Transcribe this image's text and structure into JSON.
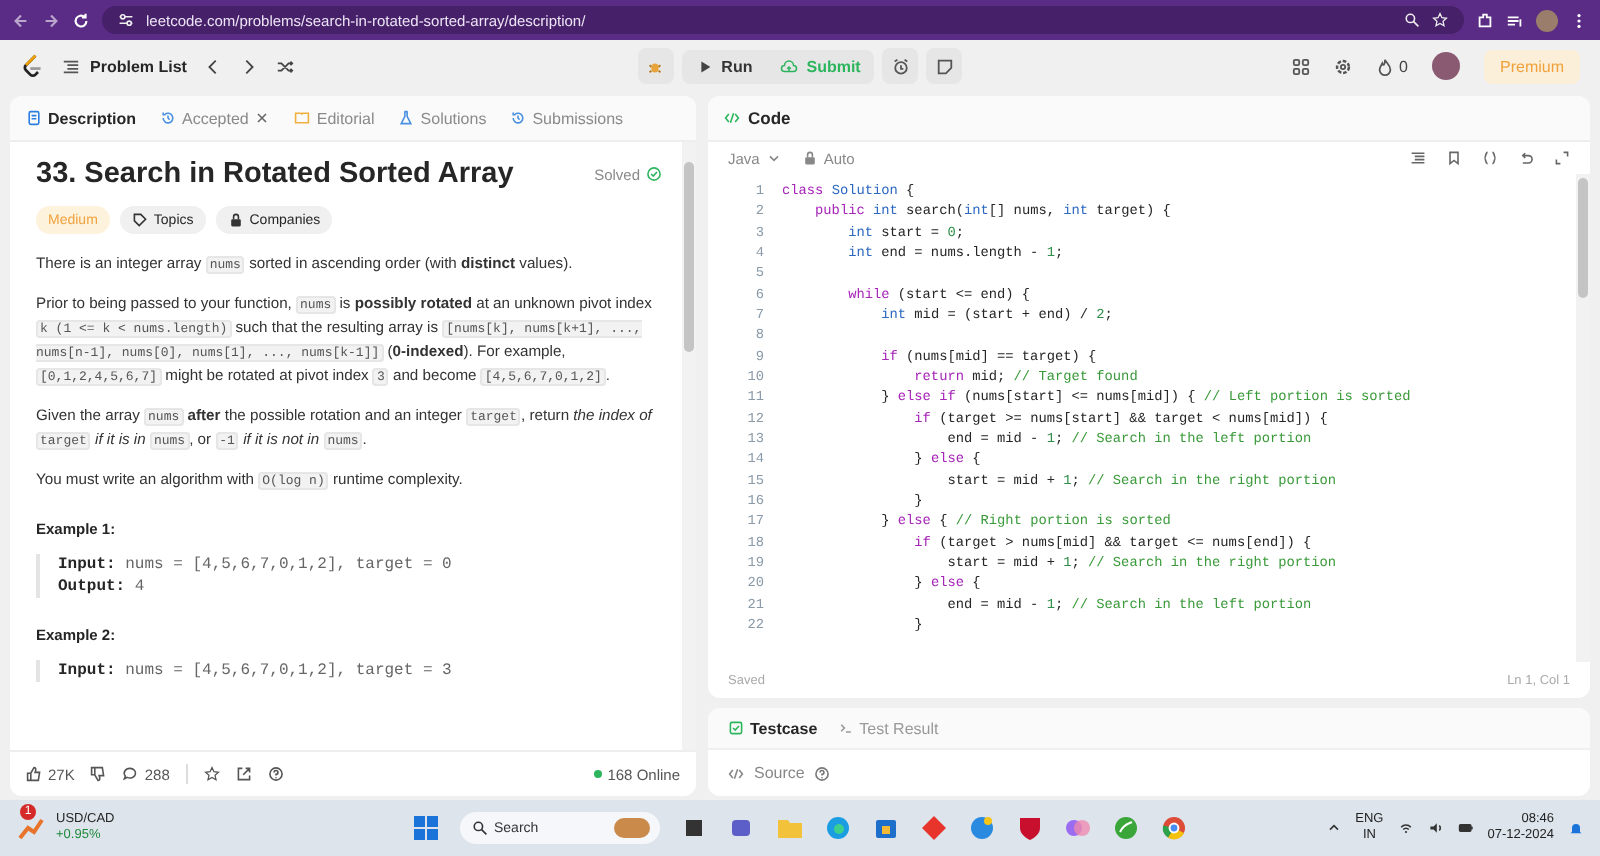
{
  "browser": {
    "url": "leetcode.com/problems/search-in-rotated-sorted-array/description/"
  },
  "nav": {
    "problem_list": "Problem List",
    "run": "Run",
    "submit": "Submit",
    "streak": "0",
    "premium": "Premium"
  },
  "description_tabs": [
    {
      "label": "Description",
      "selected": true,
      "closable": false
    },
    {
      "label": "Accepted",
      "selected": false,
      "closable": true
    },
    {
      "label": "Editorial",
      "selected": false,
      "closable": false
    },
    {
      "label": "Solutions",
      "selected": false,
      "closable": false
    },
    {
      "label": "Submissions",
      "selected": false,
      "closable": false
    }
  ],
  "problem": {
    "title": "33. Search in Rotated Sorted Array",
    "status": "Solved",
    "difficulty": "Medium",
    "tags": [
      "Topics",
      "Companies"
    ],
    "paragraphs": [
      [
        {
          "kind": "t",
          "text": "There is an integer array "
        },
        {
          "kind": "c",
          "text": "nums"
        },
        {
          "kind": "t",
          "text": " sorted in ascending order (with "
        },
        {
          "kind": "b",
          "text": "distinct"
        },
        {
          "kind": "t",
          "text": " values)."
        }
      ],
      [
        {
          "kind": "t",
          "text": "Prior to being passed to your function, "
        },
        {
          "kind": "c",
          "text": "nums"
        },
        {
          "kind": "t",
          "text": " is "
        },
        {
          "kind": "b",
          "text": "possibly rotated"
        },
        {
          "kind": "t",
          "text": " at an unknown pivot index "
        },
        {
          "kind": "c",
          "text": "k (1 <= k < nums.length)"
        },
        {
          "kind": "t",
          "text": " such that the resulting array is "
        },
        {
          "kind": "c",
          "text": "[nums[k], nums[k+1], ..., nums[n-1], nums[0], nums[1], ..., nums[k-1]]"
        },
        {
          "kind": "t",
          "text": " ("
        },
        {
          "kind": "b",
          "text": "0-indexed"
        },
        {
          "kind": "t",
          "text": "). For example, "
        },
        {
          "kind": "c",
          "text": "[0,1,2,4,5,6,7]"
        },
        {
          "kind": "t",
          "text": " might be rotated at pivot index "
        },
        {
          "kind": "c",
          "text": "3"
        },
        {
          "kind": "t",
          "text": " and become "
        },
        {
          "kind": "c",
          "text": "[4,5,6,7,0,1,2]"
        },
        {
          "kind": "t",
          "text": "."
        }
      ],
      [
        {
          "kind": "t",
          "text": "Given the array "
        },
        {
          "kind": "c",
          "text": "nums"
        },
        {
          "kind": "b",
          "text": " after"
        },
        {
          "kind": "t",
          "text": " the possible rotation and an integer "
        },
        {
          "kind": "c",
          "text": "target"
        },
        {
          "kind": "t",
          "text": ", return "
        },
        {
          "kind": "i",
          "text": "the index of "
        },
        {
          "kind": "c",
          "text": "target"
        },
        {
          "kind": "i",
          "text": " if it is in "
        },
        {
          "kind": "c",
          "text": "nums"
        },
        {
          "kind": "t",
          "text": ", or "
        },
        {
          "kind": "c",
          "text": "-1"
        },
        {
          "kind": "i",
          "text": " if it is not in "
        },
        {
          "kind": "c",
          "text": "nums"
        },
        {
          "kind": "t",
          "text": "."
        }
      ],
      [
        {
          "kind": "t",
          "text": "You must write an algorithm with "
        },
        {
          "kind": "c",
          "text": "O(log n)"
        },
        {
          "kind": "t",
          "text": " runtime complexity."
        }
      ]
    ],
    "examples": [
      {
        "heading": "Example 1:",
        "lines": [
          {
            "label": "Input:",
            "value": "nums = [4,5,6,7,0,1,2], target = 0"
          },
          {
            "label": "Output:",
            "value": "4"
          }
        ]
      },
      {
        "heading": "Example 2:",
        "lines": [
          {
            "label": "Input:",
            "value": "nums = [4,5,6,7,0,1,2], target = 3"
          }
        ]
      }
    ]
  },
  "footer": {
    "likes": "27K",
    "comments": "288",
    "online": "168 Online"
  },
  "code_panel": {
    "title": "Code",
    "language": "Java",
    "mode": "Auto",
    "save_status": "Saved",
    "cursor": "Ln 1, Col 1",
    "lines": [
      {
        "n": "1",
        "t": [
          {
            "kind": "kw",
            "text": "class "
          },
          {
            "kind": "ty",
            "text": "Solution"
          },
          {
            "kind": "tx",
            "text": " {"
          }
        ]
      },
      {
        "n": "2",
        "t": [
          {
            "kind": "kw",
            "text": "    public "
          },
          {
            "kind": "ty",
            "text": "int "
          },
          {
            "kind": "tx",
            "text": "search("
          },
          {
            "kind": "ty",
            "text": "int"
          },
          {
            "kind": "tx",
            "text": "[] nums, "
          },
          {
            "kind": "ty",
            "text": "int "
          },
          {
            "kind": "tx",
            "text": "target) {"
          }
        ]
      },
      {
        "n": "3",
        "t": [
          {
            "kind": "ty",
            "text": "        int "
          },
          {
            "kind": "tx",
            "text": "start = "
          },
          {
            "kind": "nm",
            "text": "0"
          },
          {
            "kind": "tx",
            "text": ";"
          }
        ]
      },
      {
        "n": "4",
        "t": [
          {
            "kind": "ty",
            "text": "        int "
          },
          {
            "kind": "tx",
            "text": "end = nums.length - "
          },
          {
            "kind": "nm",
            "text": "1"
          },
          {
            "kind": "tx",
            "text": ";"
          }
        ]
      },
      {
        "n": "5"
      },
      {
        "n": "6",
        "t": [
          {
            "kind": "kw",
            "text": "        while "
          },
          {
            "kind": "tx",
            "text": "(start <= end) {"
          }
        ]
      },
      {
        "n": "7",
        "t": [
          {
            "kind": "ty",
            "text": "            int "
          },
          {
            "kind": "tx",
            "text": "mid = (start + end) / "
          },
          {
            "kind": "nm",
            "text": "2"
          },
          {
            "kind": "tx",
            "text": ";"
          }
        ]
      },
      {
        "n": "8"
      },
      {
        "n": "9",
        "t": [
          {
            "kind": "kw",
            "text": "            if "
          },
          {
            "kind": "tx",
            "text": "(nums[mid] == target) {"
          }
        ]
      },
      {
        "n": "10",
        "t": [
          {
            "kind": "kw",
            "text": "                return "
          },
          {
            "kind": "tx",
            "text": "mid; "
          },
          {
            "kind": "cm",
            "text": "// Target found"
          }
        ]
      },
      {
        "n": "11",
        "t": [
          {
            "kind": "tx",
            "text": "            } "
          },
          {
            "kind": "kw",
            "text": "else if "
          },
          {
            "kind": "tx",
            "text": "(nums[start] <= nums[mid]) { "
          },
          {
            "kind": "cm",
            "text": "// Left portion is sorted"
          }
        ]
      },
      {
        "n": "12",
        "t": [
          {
            "kind": "kw",
            "text": "                if "
          },
          {
            "kind": "tx",
            "text": "(target >= nums[start] && target < nums[mid]) {"
          }
        ]
      },
      {
        "n": "13",
        "t": [
          {
            "kind": "tx",
            "text": "                    end = mid - "
          },
          {
            "kind": "nm",
            "text": "1"
          },
          {
            "kind": "tx",
            "text": "; "
          },
          {
            "kind": "cm",
            "text": "// Search in the left portion"
          }
        ]
      },
      {
        "n": "14",
        "t": [
          {
            "kind": "tx",
            "text": "                } "
          },
          {
            "kind": "kw",
            "text": "else "
          },
          {
            "kind": "tx",
            "text": "{"
          }
        ]
      },
      {
        "n": "15",
        "t": [
          {
            "kind": "tx",
            "text": "                    start = mid + "
          },
          {
            "kind": "nm",
            "text": "1"
          },
          {
            "kind": "tx",
            "text": "; "
          },
          {
            "kind": "cm",
            "text": "// Search in the right portion"
          }
        ]
      },
      {
        "n": "16",
        "t": [
          {
            "kind": "tx",
            "text": "                }"
          }
        ]
      },
      {
        "n": "17",
        "t": [
          {
            "kind": "tx",
            "text": "            } "
          },
          {
            "kind": "kw",
            "text": "else "
          },
          {
            "kind": "tx",
            "text": "{ "
          },
          {
            "kind": "cm",
            "text": "// Right portion is sorted"
          }
        ]
      },
      {
        "n": "18",
        "t": [
          {
            "kind": "kw",
            "text": "                if "
          },
          {
            "kind": "tx",
            "text": "(target > nums[mid] && target <= nums[end]) {"
          }
        ]
      },
      {
        "n": "19",
        "t": [
          {
            "kind": "tx",
            "text": "                    start = mid + "
          },
          {
            "kind": "nm",
            "text": "1"
          },
          {
            "kind": "tx",
            "text": "; "
          },
          {
            "kind": "cm",
            "text": "// Search in the right portion"
          }
        ]
      },
      {
        "n": "20",
        "t": [
          {
            "kind": "tx",
            "text": "                } "
          },
          {
            "kind": "kw",
            "text": "else "
          },
          {
            "kind": "tx",
            "text": "{"
          }
        ]
      },
      {
        "n": "21",
        "t": [
          {
            "kind": "tx",
            "text": "                    end = mid - "
          },
          {
            "kind": "nm",
            "text": "1"
          },
          {
            "kind": "tx",
            "text": "; "
          },
          {
            "kind": "cm",
            "text": "// Search in the left portion"
          }
        ]
      },
      {
        "n": "22",
        "t": [
          {
            "kind": "tx",
            "text": "                }"
          }
        ]
      }
    ]
  },
  "test_tabs": [
    {
      "label": "Testcase",
      "selected": true
    },
    {
      "label": "Test Result",
      "selected": false
    }
  ],
  "source": "Source",
  "taskbar": {
    "ticker": "USD/CAD",
    "change": "+0.95%",
    "badge": "1",
    "search_placeholder": "Search",
    "lang": "ENG",
    "region": "IN",
    "time": "08:46",
    "date": "07-12-2024"
  }
}
